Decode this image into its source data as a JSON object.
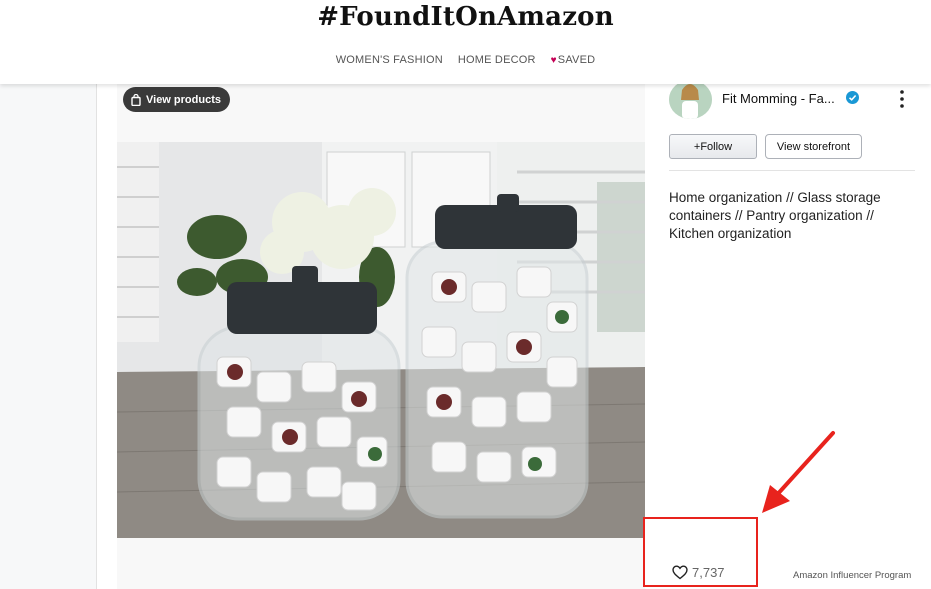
{
  "header": {
    "brand": "#FoundItOnAmazon",
    "nav": [
      "WOMEN'S FASHION",
      "HOME DECOR"
    ],
    "saved_label": "SAVED"
  },
  "media": {
    "view_products_label": "View products",
    "photo": "two glass jars with black lids filled with coffee pods, hydrangeas behind"
  },
  "creator": {
    "name": "Fit Momming - Fa...",
    "follow_label": "+Follow",
    "storefront_label": "View storefront"
  },
  "post": {
    "description": "Home organization // Glass storage containers // Pantry organization // Kitchen organization",
    "likes": "7,737",
    "program": "Amazon Influencer Program"
  },
  "colors": {
    "accent_heart": "#c40055",
    "verified": "#1a98d5",
    "annotation": "#e8231d"
  }
}
